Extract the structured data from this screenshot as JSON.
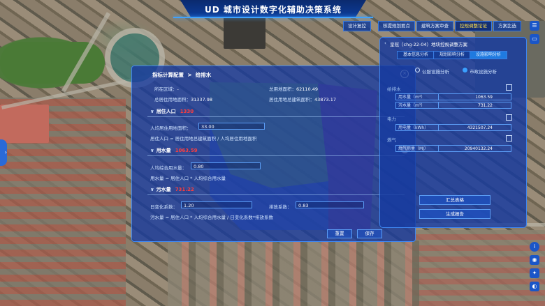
{
  "app": {
    "title": "UD 城市设计数字化辅助决策系统"
  },
  "nav": [
    {
      "label": "设计复控",
      "active": false
    },
    {
      "label": "核提规划要点",
      "active": false
    },
    {
      "label": "建筑方案审查",
      "active": false
    },
    {
      "label": "控规调整论证",
      "active": true
    },
    {
      "label": "方案比选",
      "active": false
    }
  ],
  "dialog": {
    "title": "指标计算配置",
    "subtitle": "给排水",
    "close": "×",
    "info": {
      "area_label": "所在区域：",
      "area_value": "-",
      "total_land_label": "总用地面积：",
      "total_land_value": "62110.49",
      "total_res_label": "总居住用地面积：",
      "total_res_value": "31337.98",
      "res_build_label": "居住用地总建筑面积：",
      "res_build_value": "43873.17"
    },
    "pop": {
      "title": "居住人口",
      "value": "1330",
      "per_capita_label": "人均居住用地面积：",
      "per_capita_value": "33.00",
      "formula": "居住人口 = 居住用地总建筑面积 / 人均居住用地面积"
    },
    "water": {
      "title": "用水量",
      "value": "1063.59",
      "per_capita_label": "人均综合用水量：",
      "per_capita_value": "0.80",
      "formula": "用水量 = 居住人口 * 人均综合用水量"
    },
    "sewage": {
      "title": "污水量",
      "value": "731.22",
      "daily_label": "日变化系数：",
      "daily_value": "1.20",
      "discharge_label": "排放系数：",
      "discharge_value": "0.83",
      "formula": "污水量 = 居住人口 * 人均综合用水量 / 日变化系数*排放系数"
    },
    "reset": "重置",
    "save": "保存"
  },
  "right_panel": {
    "title": "皇冠（chg-22-04）地块控规调整方案",
    "tabs": [
      {
        "label": "基本信息分析",
        "active": false
      },
      {
        "label": "规划影响分析",
        "active": false
      },
      {
        "label": "设施影响分析",
        "active": true
      }
    ],
    "radios": [
      {
        "label": "公服设施分析",
        "on": false
      },
      {
        "label": "市政设施分析",
        "on": true
      }
    ],
    "sections": [
      "给排水",
      "电力",
      "燃气"
    ],
    "rows": [
      {
        "key": "用水量（m³）",
        "value": "1063.59"
      },
      {
        "key": "污水量（m³）",
        "value": "731.22"
      },
      {
        "key": "用电量（kWh）",
        "value": "4321507.24"
      },
      {
        "key": "燃气用量（MJ）",
        "value": "20940132.24"
      }
    ],
    "summary_btn": "汇总表格",
    "report_btn": "生成报告"
  },
  "pager": {
    "prev": "‹",
    "next": "›"
  },
  "side_icons": [
    "list-icon",
    "device-icon",
    "info-icon",
    "camera-icon",
    "compass-icon",
    "eye-icon"
  ]
}
